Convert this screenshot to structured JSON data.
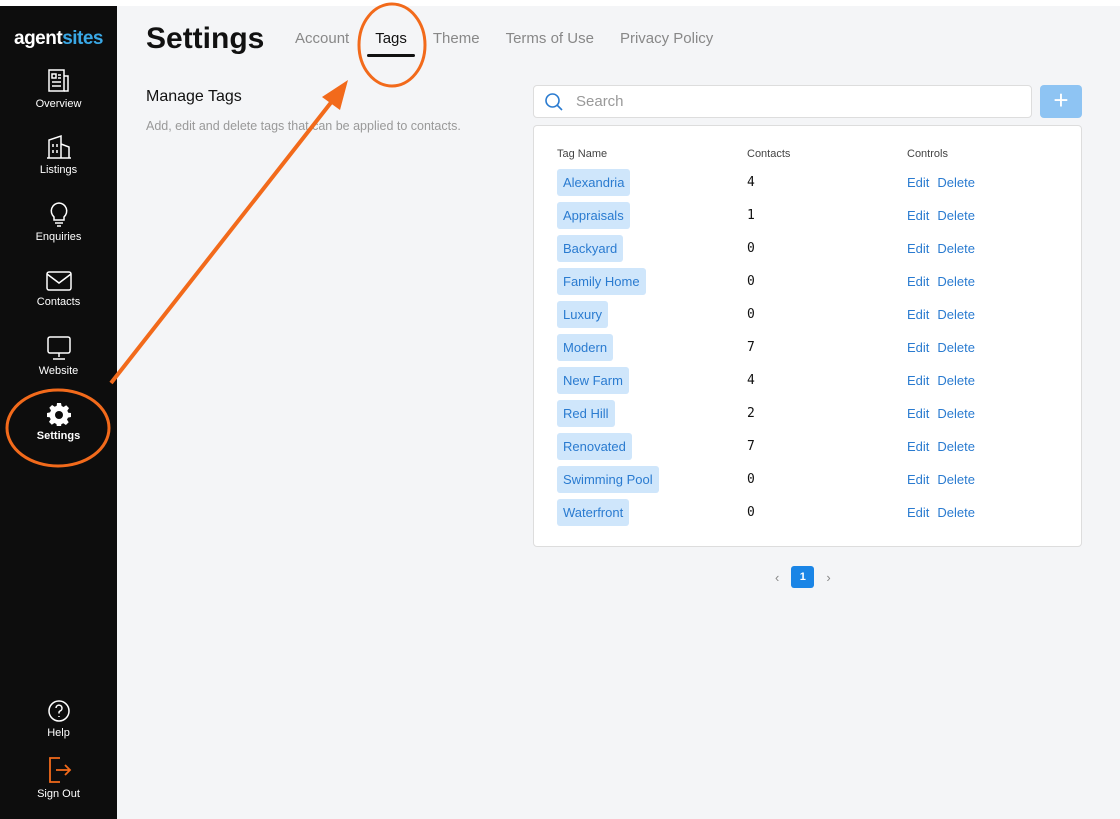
{
  "brand": {
    "part1": "agent",
    "part2": "sites"
  },
  "sidebar": {
    "items": [
      {
        "label": "Overview",
        "icon": "newspaper-icon"
      },
      {
        "label": "Listings",
        "icon": "building-icon"
      },
      {
        "label": "Enquiries",
        "icon": "lightbulb-icon"
      },
      {
        "label": "Contacts",
        "icon": "envelope-icon"
      },
      {
        "label": "Website",
        "icon": "monitor-icon"
      },
      {
        "label": "Settings",
        "icon": "gear-icon"
      }
    ],
    "bottom": [
      {
        "label": "Help",
        "icon": "question-icon"
      },
      {
        "label": "Sign Out",
        "icon": "sign-out-icon"
      }
    ]
  },
  "header": {
    "title": "Settings",
    "tabs": [
      "Account",
      "Tags",
      "Theme",
      "Terms of Use",
      "Privacy Policy"
    ],
    "active_tab": "Tags"
  },
  "section": {
    "title": "Manage Tags",
    "description": "Add, edit and delete tags that can be applied to contacts."
  },
  "search": {
    "placeholder": "Search"
  },
  "add_button": "+",
  "table": {
    "headers": [
      "Tag Name",
      "Contacts",
      "Controls"
    ],
    "rows": [
      {
        "name": "Alexandria",
        "contacts": "4"
      },
      {
        "name": "Appraisals",
        "contacts": "1"
      },
      {
        "name": "Backyard",
        "contacts": "0"
      },
      {
        "name": "Family Home",
        "contacts": "0"
      },
      {
        "name": "Luxury",
        "contacts": "0"
      },
      {
        "name": "Modern",
        "contacts": "7"
      },
      {
        "name": "New Farm",
        "contacts": "4"
      },
      {
        "name": "Red Hill",
        "contacts": "2"
      },
      {
        "name": "Renovated",
        "contacts": "7"
      },
      {
        "name": "Swimming Pool",
        "contacts": "0"
      },
      {
        "name": "Waterfront",
        "contacts": "0"
      }
    ],
    "edit_label": "Edit",
    "delete_label": "Delete"
  },
  "pagination": {
    "current": "1",
    "prev": "‹",
    "next": "›"
  },
  "annotation_color": "#f26a1b"
}
